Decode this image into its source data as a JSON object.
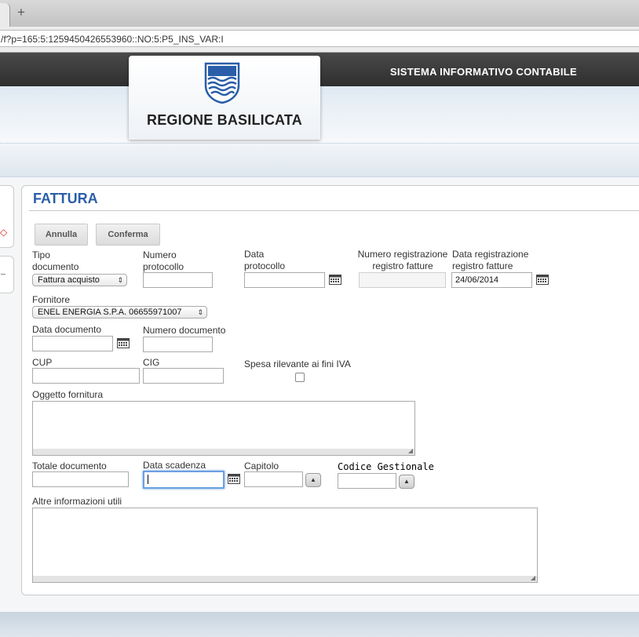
{
  "browser": {
    "new_tab_symbol": "+",
    "url": "/f?p=165:5:1259450426553960::NO:5:P5_INS_VAR:I"
  },
  "header": {
    "system_name": "SISTEMA INFORMATIVO CONTABILE",
    "region_name": "REGIONE BASILICATA"
  },
  "panel": {
    "title": "FATTURA",
    "buttons": {
      "cancel": "Annulla",
      "confirm": "Conferma"
    }
  },
  "form": {
    "tipo_documento": {
      "label": "Tipo\ndocumento",
      "value": "Fattura acquisto"
    },
    "numero_protocollo": {
      "label": "Numero\nprotocollo",
      "value": ""
    },
    "data_protocollo": {
      "label": "Data\nprotocollo",
      "value": ""
    },
    "numero_registrazione": {
      "label": "Numero registrazione\nregistro fatture",
      "value": ""
    },
    "data_registrazione": {
      "label": "Data registrazione\nregistro fatture",
      "value": "24/06/2014"
    },
    "fornitore": {
      "label": "Fornitore",
      "value": "ENEL ENERGIA S.P.A. 06655971007"
    },
    "data_documento": {
      "label": "Data documento",
      "value": ""
    },
    "numero_documento": {
      "label": "Numero documento",
      "value": ""
    },
    "cup": {
      "label": "CUP",
      "value": ""
    },
    "cig": {
      "label": "CIG",
      "value": ""
    },
    "spesa_iva": {
      "label": "Spesa rilevante ai fini IVA",
      "checked": false
    },
    "oggetto_fornitura": {
      "label": "Oggetto fornitura",
      "value": ""
    },
    "totale_documento": {
      "label": "Totale documento",
      "value": ""
    },
    "data_scadenza": {
      "label": "Data scadenza",
      "value": ""
    },
    "capitolo": {
      "label": "Capitolo",
      "value": ""
    },
    "codice_gestionale": {
      "label": "Codice Gestionale",
      "value": ""
    },
    "altre_informazioni": {
      "label": "Altre informazioni utili",
      "value": ""
    }
  },
  "icons": {
    "calendar": "calendar-icon",
    "select_arrow": "⇕",
    "lookup_arrow": "▲",
    "side_arrow": "◇"
  },
  "colors": {
    "title_blue": "#2a5ea8",
    "header_dark": "#3a3a3a",
    "focus_blue": "#6aa0e0"
  }
}
